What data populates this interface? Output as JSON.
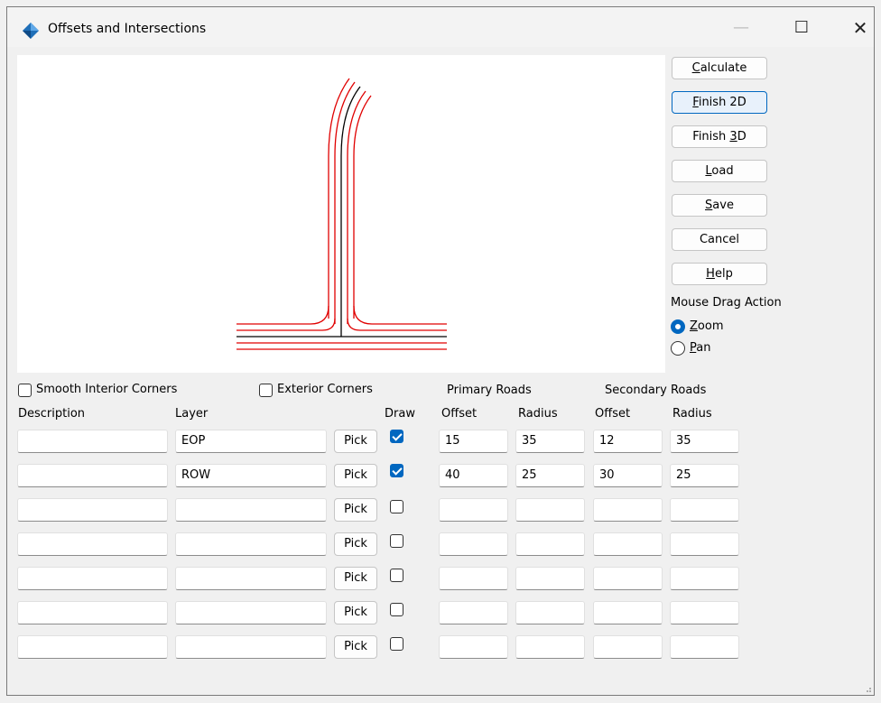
{
  "window": {
    "title": "Offsets and Intersections",
    "minimize_glyph": "—",
    "maximize_glyph": "☐",
    "close_glyph": "✕"
  },
  "buttons": {
    "calculate": {
      "pre": "",
      "key": "C",
      "post": "alculate"
    },
    "finish2d": {
      "pre": "",
      "key": "F",
      "post": "inish 2D"
    },
    "finish3d": {
      "pre": "Finish ",
      "key": "3",
      "post": "D"
    },
    "load": {
      "pre": "",
      "key": "L",
      "post": "oad"
    },
    "save": {
      "pre": "",
      "key": "S",
      "post": "ave"
    },
    "cancel": {
      "pre": "Cancel",
      "key": "",
      "post": ""
    },
    "help": {
      "pre": "",
      "key": "H",
      "post": "elp"
    }
  },
  "mouse_drag": {
    "heading": "Mouse Drag Action",
    "zoom": {
      "key": "Z",
      "rest": "oom",
      "selected": true
    },
    "pan": {
      "key": "P",
      "rest": "an",
      "selected": false
    }
  },
  "options": {
    "smooth_interior": {
      "label": "Smooth Interior Corners",
      "checked": false
    },
    "exterior": {
      "label": "Exterior Corners",
      "checked": false
    }
  },
  "headers": {
    "primary": "Primary Roads",
    "secondary": "Secondary Roads",
    "description": "Description",
    "layer": "Layer",
    "draw": "Draw",
    "offset1": "Offset",
    "radius1": "Radius",
    "offset2": "Offset",
    "radius2": "Radius"
  },
  "pick_label": "Pick",
  "rows": [
    {
      "description": "",
      "layer": "EOP",
      "draw": true,
      "p_offset": "15",
      "p_radius": "35",
      "s_offset": "12",
      "s_radius": "35"
    },
    {
      "description": "",
      "layer": "ROW",
      "draw": true,
      "p_offset": "40",
      "p_radius": "25",
      "s_offset": "30",
      "s_radius": "25"
    },
    {
      "description": "",
      "layer": "",
      "draw": false,
      "p_offset": "",
      "p_radius": "",
      "s_offset": "",
      "s_radius": ""
    },
    {
      "description": "",
      "layer": "",
      "draw": false,
      "p_offset": "",
      "p_radius": "",
      "s_offset": "",
      "s_radius": ""
    },
    {
      "description": "",
      "layer": "",
      "draw": false,
      "p_offset": "",
      "p_radius": "",
      "s_offset": "",
      "s_radius": ""
    },
    {
      "description": "",
      "layer": "",
      "draw": false,
      "p_offset": "",
      "p_radius": "",
      "s_offset": "",
      "s_radius": ""
    },
    {
      "description": "",
      "layer": "",
      "draw": false,
      "p_offset": "",
      "p_radius": "",
      "s_offset": "",
      "s_radius": ""
    }
  ],
  "colors": {
    "accent": "#0067c0",
    "centerline": "#000000",
    "offset_line": "#e00000"
  }
}
